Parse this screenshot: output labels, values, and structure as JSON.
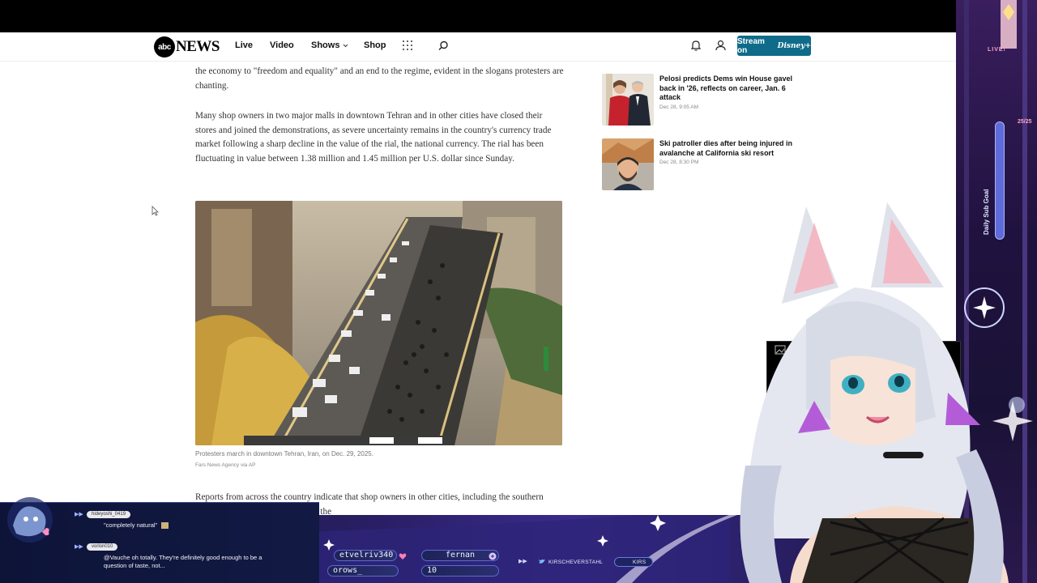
{
  "nav": {
    "logo_circle": "abc",
    "logo_text": "NEWS",
    "links": [
      "Live",
      "Video",
      "Shows",
      "Shop"
    ],
    "stream_label": "Stream on",
    "stream_brand": "Disney+"
  },
  "article": {
    "para1": "the economy to \"freedom and equality\" and an end to the regime, evident in the slogans protesters are chanting.",
    "para2": "Many shop owners in two major malls in downtown Tehran and in other cities have closed their stores and joined the demonstrations, as severe uncertainty remains in the country's currency trade market following a sharp decline in the value of the rial, the national currency. The rial has been fluctuating in value between 1.38 million and 1.45 million per U.S. dollar since Sunday.",
    "caption": "Protesters march in downtown Tehran, Iran, on Dec. 29, 2025.",
    "credit": "Fars News Agency via AP",
    "para3": "Reports from across the country indicate that shop owners in other cities, including the southern island of Qeshm, have also joined the"
  },
  "sidebar": {
    "items": [
      {
        "title": "Pelosi predicts Dems win House gavel back in '26, reflects on career, Jan. 6 attack",
        "time": "Dec 28, 9:05 AM"
      },
      {
        "title": "Ski patroller dies after being injured in avalanche at California ski resort",
        "time": "Dec 28, 8:30 PM"
      }
    ]
  },
  "stream": {
    "live_label": "LIVE!",
    "sub_count": "25/25",
    "sub_goal": "Daily Sub Goal",
    "chat": [
      {
        "user": "hideyoshi_0419",
        "message": "\"completely natural\""
      },
      {
        "user": "vorlon010",
        "message": "@Vauche oh totally. They're definitely good enough to be a question of taste, not..."
      }
    ],
    "ticker": [
      "etvelriv340",
      "fernan",
      "orows_",
      "10"
    ],
    "ticker_names": [
      "KIRSCHEVERSTAHL",
      "KIRS"
    ]
  },
  "colors": {
    "stream_button": "#0f6b8a",
    "overlay_purple": "#2a1f66",
    "accent_pink": "#f7a7c7"
  }
}
